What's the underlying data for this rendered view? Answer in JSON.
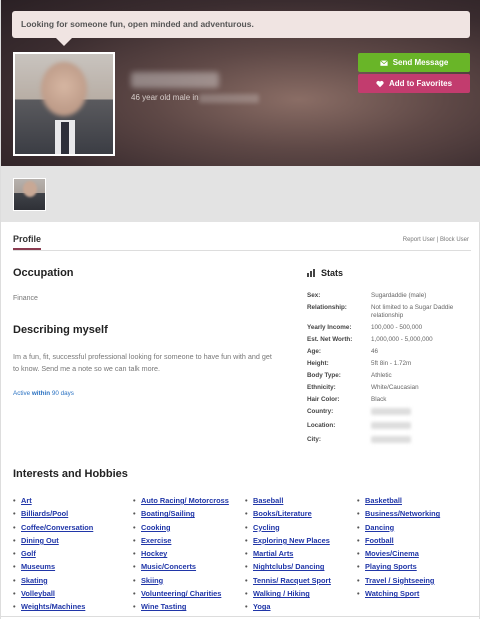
{
  "header": {
    "tagline": "Looking for someone fun, open minded and adventurous.",
    "age_line": "46 year old male in",
    "send_label": "Send Message",
    "fav_label": "Add to Favorites",
    "colors": {
      "send": "#69b528",
      "fav": "#c23c6e"
    }
  },
  "tabs": {
    "profile": "Profile"
  },
  "report": {
    "report_user": "Report User",
    "sep": "|",
    "block_user": "Block User"
  },
  "occupation": {
    "heading": "Occupation",
    "value": "Finance"
  },
  "describing": {
    "heading": "Describing myself",
    "text": "Im a fun, fit, successful professional looking for someone to have fun with and get to know. Send me a note so we can talk more."
  },
  "activity": {
    "prefix": "Active",
    "bold": "within",
    "suffix": "90 days"
  },
  "stats": {
    "heading": "Stats",
    "rows": [
      {
        "label": "Sex:",
        "value": "Sugardaddie (male)"
      },
      {
        "label": "Relationship:",
        "value": "Not limited to a Sugar Daddie relationship"
      },
      {
        "label": "Yearly Income:",
        "value": "100,000 - 500,000"
      },
      {
        "label": "Est. Net Worth:",
        "value": "1,000,000 - 5,000,000"
      },
      {
        "label": "Age:",
        "value": "46"
      },
      {
        "label": "Height:",
        "value": "5ft 8in - 1.72m"
      },
      {
        "label": "Body Type:",
        "value": "Athletic"
      },
      {
        "label": "Ethnicity:",
        "value": "White/Caucasian"
      },
      {
        "label": "Hair Color:",
        "value": "Black"
      },
      {
        "label": "Country:",
        "value": ""
      },
      {
        "label": "Location:",
        "value": ""
      },
      {
        "label": "City:",
        "value": ""
      }
    ]
  },
  "interests": {
    "heading": "Interests and Hobbies",
    "columns": [
      [
        "Art",
        "Billiards/Pool",
        "Coffee/Conversation",
        "Dining Out",
        "Golf",
        "Museums",
        "Skating",
        "Volleyball",
        "Weights/Machines"
      ],
      [
        "Auto Racing/ Motorcross",
        "Boating/Sailing",
        "Cooking",
        "Exercise",
        "Hockey",
        "Music/Concerts",
        "Skiing",
        "Volunteering/ Charities",
        "Wine Tasting"
      ],
      [
        "Baseball",
        "Books/Literature",
        "Cycling",
        "Exploring New Places",
        "Martial Arts",
        "Nightclubs/ Dancing",
        "Tennis/ Racquet Sport",
        "Walking / Hiking",
        "Yoga"
      ],
      [
        "Basketball",
        "Business/Networking",
        "Dancing",
        "Football",
        "Movies/Cinema",
        "Playing Sports",
        "Travel / Sightseeing",
        "Watching Sport"
      ]
    ]
  }
}
